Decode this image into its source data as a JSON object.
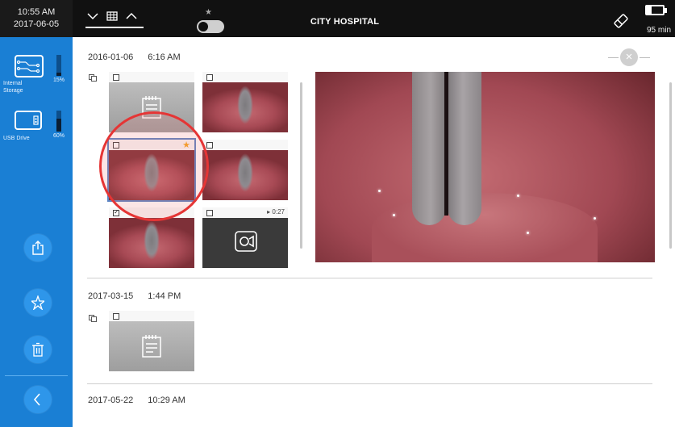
{
  "clock": {
    "time": "10:55 AM",
    "date": "2017-06-05"
  },
  "header": {
    "title": "CITY HOSPITAL",
    "battery_text": "95 min",
    "battery_fill_fraction": 0.3
  },
  "view_selector": {
    "icons": [
      "chevron-down-icon",
      "grid-icon",
      "chevron-up-icon"
    ]
  },
  "sidebar": {
    "storages": [
      {
        "label": "Internal Storage",
        "percent_text": "15%",
        "level": 0.15,
        "icon": "internal-storage-icon"
      },
      {
        "label": "USB Drive",
        "percent_text": "60%",
        "level": 0.6,
        "icon": "usb-drive-icon"
      }
    ],
    "buttons": [
      "export-icon",
      "star-icon",
      "trash-icon",
      "back-icon"
    ]
  },
  "sessions": [
    {
      "date": "2016-01-06",
      "time": "6:16 AM",
      "items": [
        {
          "type": "note",
          "checked": false,
          "starred": false
        },
        {
          "type": "image",
          "checked": false,
          "starred": false
        },
        {
          "type": "image",
          "checked": false,
          "starred": true,
          "selected": true
        },
        {
          "type": "image",
          "checked": false,
          "starred": false
        },
        {
          "type": "image",
          "checked": true,
          "starred": false
        },
        {
          "type": "video",
          "checked": false,
          "starred": false,
          "duration": "0:27"
        }
      ]
    },
    {
      "date": "2017-03-15",
      "time": "1:44 PM",
      "items": [
        {
          "type": "note",
          "checked": false,
          "starred": false
        }
      ]
    },
    {
      "date": "2017-05-22",
      "time": "10:29 AM",
      "items": []
    }
  ],
  "colors": {
    "sidebar": "#1a7fd4",
    "topbar": "#111111",
    "highlight": "#e53535",
    "star": "#f5a623"
  }
}
